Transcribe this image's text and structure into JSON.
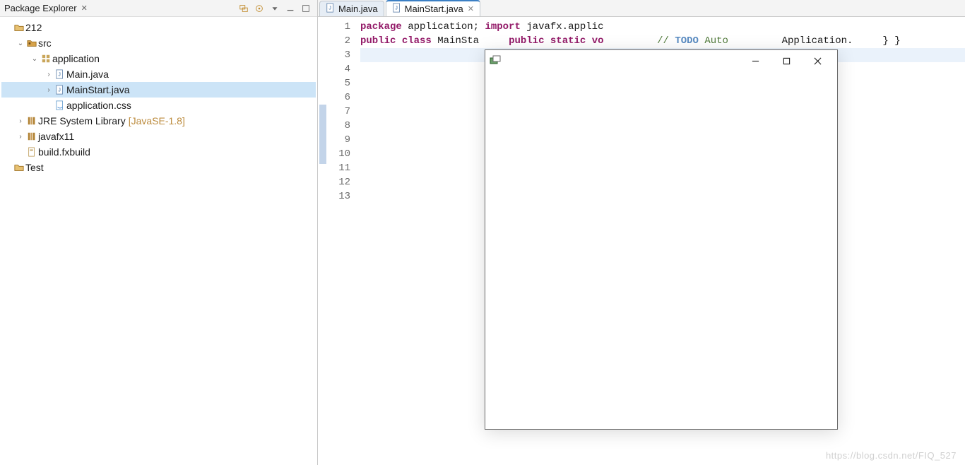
{
  "explorer": {
    "title": "Package Explorer",
    "toolbar": [
      "link-editor",
      "focus",
      "view-menu",
      "minimize",
      "maximize"
    ],
    "tree": {
      "project": "212",
      "src": "src",
      "package": "application",
      "main": "Main.java",
      "mainstart": "MainStart.java",
      "css": "application.css",
      "jre": "JRE System Library",
      "jreBadge": "[JavaSE-1.8]",
      "javafx": "javafx11",
      "build": "build.fxbuild",
      "test": "Test"
    }
  },
  "editor": {
    "tabs": [
      {
        "label": "Main.java",
        "active": false
      },
      {
        "label": "MainStart.java",
        "active": true
      }
    ],
    "lines": [
      "1",
      "2",
      "3",
      "4",
      "5",
      "6",
      "7",
      "8",
      "9",
      "10",
      "11",
      "12",
      "13"
    ],
    "code": {
      "l1a": "package",
      "l1b": " application;",
      "l3a": "import",
      "l3b": " javafx.applic",
      "l5a": "public",
      "l5b": " class",
      "l5c": " MainSta",
      "l7a": "    public",
      "l7b": " static",
      "l7c": " vo",
      "l8a": "        // ",
      "l8todo": "TODO",
      "l8b": " Auto",
      "l9": "        Application.",
      "l10": "    }",
      "l12": "}"
    }
  },
  "fxwindow": {
    "title": ""
  },
  "watermark": "https://blog.csdn.net/FIQ_527"
}
